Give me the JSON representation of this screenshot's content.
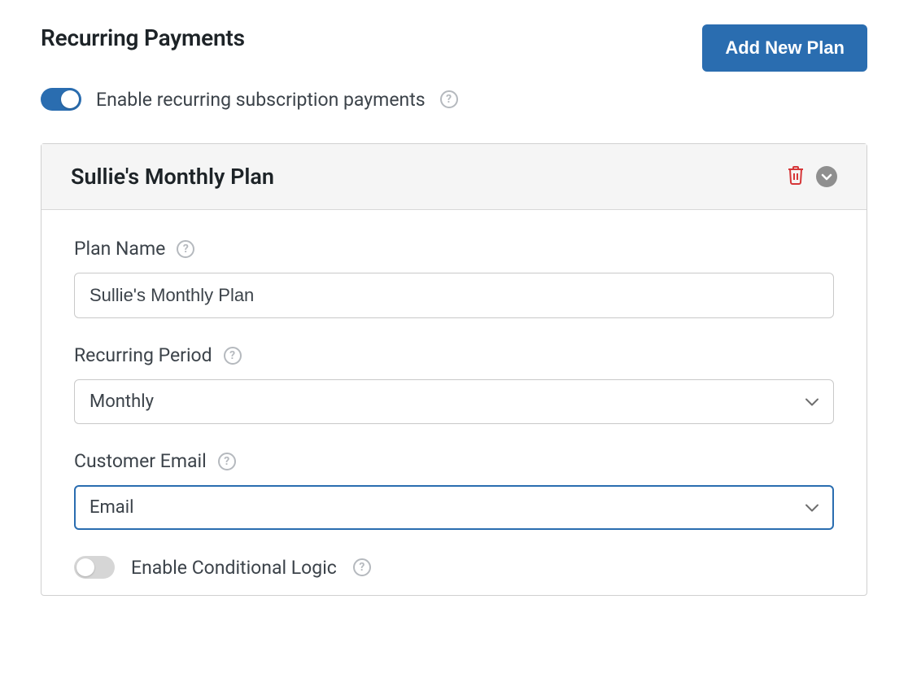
{
  "header": {
    "title": "Recurring Payments",
    "add_button_label": "Add New Plan"
  },
  "enable_toggle": {
    "label": "Enable recurring subscription payments",
    "value": true
  },
  "plan": {
    "title": "Sullie's Monthly Plan",
    "fields": {
      "plan_name": {
        "label": "Plan Name",
        "value": "Sullie's Monthly Plan"
      },
      "recurring_period": {
        "label": "Recurring Period",
        "value": "Monthly"
      },
      "customer_email": {
        "label": "Customer Email",
        "value": "Email"
      },
      "conditional_logic": {
        "label": "Enable Conditional Logic",
        "value": false
      }
    }
  },
  "colors": {
    "accent": "#2a6db0",
    "danger": "#d63638"
  }
}
